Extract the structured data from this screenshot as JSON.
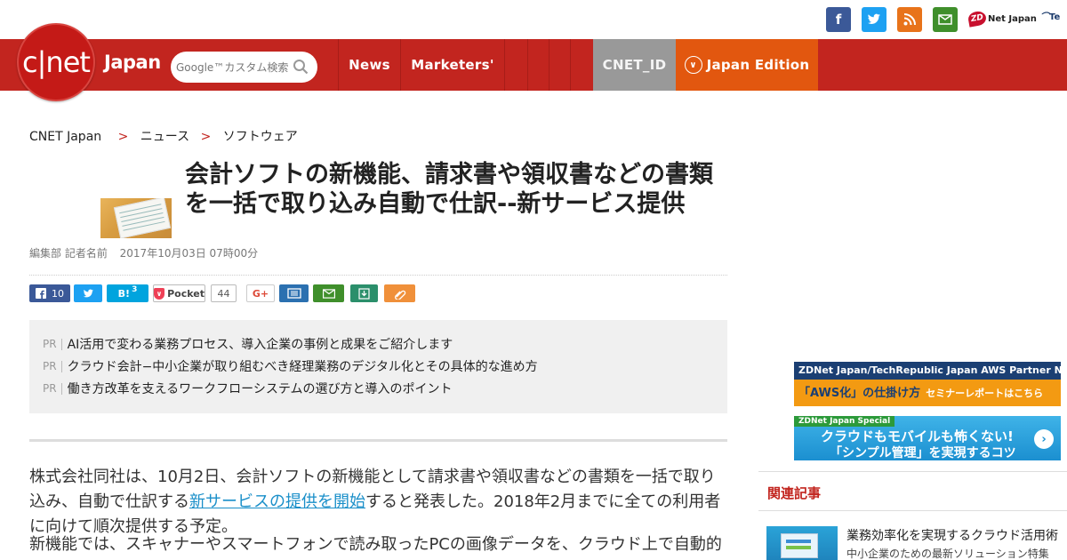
{
  "colors": {
    "brand_red": "#c2251f",
    "edition_orange": "#e2570f",
    "cnetid_gray": "#999999",
    "facebook": "#3b5998",
    "twitter": "#1da1f2",
    "rss": "#e8731a",
    "mail": "#3f8f2b",
    "link_blue": "#1a8fc9"
  },
  "topbar": {
    "social_icons": [
      "facebook-icon",
      "twitter-icon",
      "rss-icon",
      "mail-icon"
    ],
    "zdnet_badge": "ZD",
    "zdnet_text": "Net Japan",
    "techrepublic_text": "Te"
  },
  "header": {
    "logo_text": "c|net",
    "logo_japan": "Japan",
    "search_placeholder": "Google™カスタム検索",
    "nav": {
      "news": "News",
      "marketers": "Marketers'",
      "cnet_id": "CNET_ID",
      "japan_edition": "Japan Edition"
    }
  },
  "breadcrumb": {
    "home": "CNET Japan",
    "sep": ">",
    "level1": "ニュース",
    "level2": "ソフトウェア"
  },
  "article": {
    "title": "会計ソフトの新機能、請求書や領収書などの書類を一括で取り込み自動で仕訳--新サービス提供",
    "author": "編集部 記者名前",
    "date": "2017年10月03日 07時00分"
  },
  "share": {
    "facebook_count": "10",
    "hatena_label": "B!",
    "hatena_count": "3",
    "pocket_label": "Pocket",
    "pocket_count": "44",
    "gplus_label": "G+"
  },
  "pr": {
    "tag": "PR",
    "items": [
      "AI活用で変わる業務プロセス、導入企業の事例と成果をご紹介します",
      "クラウド会計−中小企業が取り組むべき経理業務のデジタル化とその具体的な進め方",
      "働き方改革を支えるワークフローシステムの選び方と導入のポイント"
    ]
  },
  "body": {
    "p1_before": "株式会社同社は、10月2日、会計ソフトの新機能として請求書や領収書などの書類を一括で取り込み、自動で仕訳する",
    "p1_link": "新サービスの提供を開始",
    "p1_after": "すると発表した。2018年2月までに全ての利用者に向けて順次提供する予定。",
    "p2": "新機能では、スキャナーやスマートフォンで読み取ったPCの画像データを、クラウド上で自動的に認識し、PCの会計ソフトに取り込むことができる。"
  },
  "sidebar": {
    "aws_banner_top": "ZDNet Japan/TechRepublic Japan  AWS Partner Network",
    "aws_banner_main": "「AWS化」の仕掛け方",
    "aws_banner_sub": "セミナーレポートはこちら",
    "cloud_banner_tag": "ZDNet Japan Special",
    "cloud_banner_line1": "クラウドもモバイルも怖くない!",
    "cloud_banner_line2": "「シンプル管理」を実現するコツ",
    "heading": "関連記事",
    "related_title": "業務効率化を実現するクラウド活用術",
    "related_sub": "中小企業のための最新ソリューション特集"
  }
}
